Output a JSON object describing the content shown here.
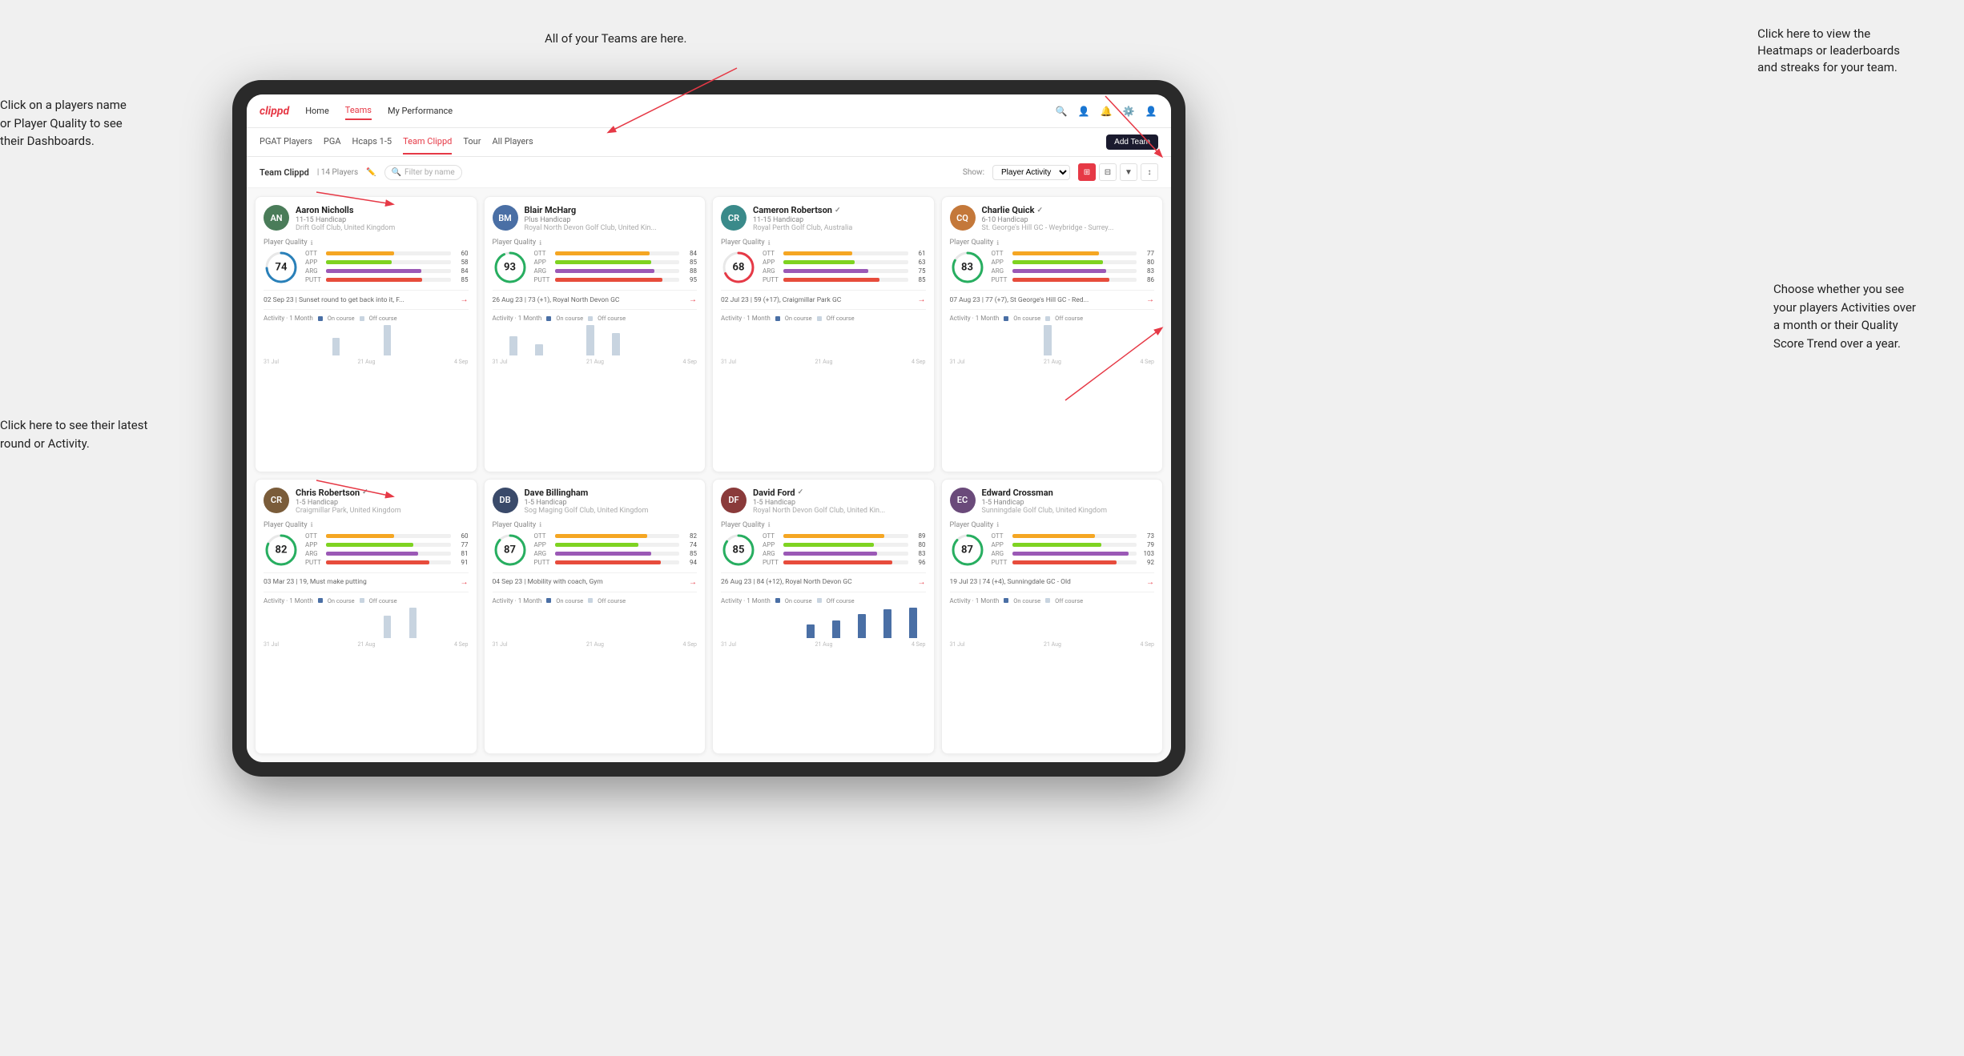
{
  "annotations": {
    "teams_label": "All of your Teams are here.",
    "heatmaps_label": "Click here to view the\nHeatmaps or leaderboards\nand streaks for your team.",
    "players_label": "Click on a players name\nor Player Quality to see\ntheir Dashboards.",
    "round_label": "Click here to see their latest\nround or Activity.",
    "activity_label": "Choose whether you see\nyour players Activities over\na month or their Quality\nScore Trend over a year."
  },
  "nav": {
    "logo": "clippd",
    "items": [
      "Home",
      "Teams",
      "My Performance"
    ],
    "active": "Teams"
  },
  "tabs": {
    "items": [
      "PGAT Players",
      "PGA",
      "Hcaps 1-5",
      "Team Clippd",
      "Tour",
      "All Players"
    ],
    "active": "Team Clippd",
    "add_team": "Add Team"
  },
  "team_header": {
    "title": "Team Clippd",
    "separator": "|",
    "count": "14 Players",
    "search_placeholder": "Filter by name",
    "show_label": "Show:",
    "show_option": "Player Activity",
    "view_options": [
      "grid",
      "grid4",
      "filter",
      "sort"
    ]
  },
  "players": [
    {
      "name": "Aaron Nicholls",
      "handicap": "11-15 Handicap",
      "club": "Drift Golf Club, United Kingdom",
      "quality": 74,
      "stats": [
        {
          "label": "OTT",
          "value": 60,
          "color": "#f5a623"
        },
        {
          "label": "APP",
          "value": 58,
          "color": "#7ed321"
        },
        {
          "label": "ARG",
          "value": 84,
          "color": "#9b59b6"
        },
        {
          "label": "PUTT",
          "value": 85,
          "color": "#e74c3c"
        }
      ],
      "latest_round": "02 Sep 23 | Sunset round to get back into it, F...",
      "activity_bars": [
        0,
        0,
        0,
        0,
        0,
        0,
        0,
        0,
        20,
        0,
        0,
        0,
        0,
        0,
        35,
        0,
        0,
        0,
        0,
        0,
        0,
        0,
        0,
        0
      ],
      "axis_labels": [
        "31 Jul",
        "21 Aug",
        "4 Sep"
      ],
      "initials": "AN",
      "av_class": "av-green"
    },
    {
      "name": "Blair McHarg",
      "handicap": "Plus Handicap",
      "club": "Royal North Devon Golf Club, United Kin...",
      "quality": 93,
      "stats": [
        {
          "label": "OTT",
          "value": 84,
          "color": "#f5a623"
        },
        {
          "label": "APP",
          "value": 85,
          "color": "#7ed321"
        },
        {
          "label": "ARG",
          "value": 88,
          "color": "#9b59b6"
        },
        {
          "label": "PUTT",
          "value": 95,
          "color": "#e74c3c"
        }
      ],
      "latest_round": "26 Aug 23 | 73 (+1), Royal North Devon GC",
      "activity_bars": [
        0,
        0,
        25,
        0,
        0,
        15,
        0,
        0,
        0,
        0,
        0,
        40,
        0,
        0,
        30,
        0,
        0,
        0,
        0,
        0,
        0,
        0,
        0,
        0
      ],
      "axis_labels": [
        "31 Jul",
        "21 Aug",
        "4 Sep"
      ],
      "initials": "BM",
      "av_class": "av-blue"
    },
    {
      "name": "Cameron Robertson",
      "verified": true,
      "handicap": "11-15 Handicap",
      "club": "Royal Perth Golf Club, Australia",
      "quality": 68,
      "stats": [
        {
          "label": "OTT",
          "value": 61,
          "color": "#f5a623"
        },
        {
          "label": "APP",
          "value": 63,
          "color": "#7ed321"
        },
        {
          "label": "ARG",
          "value": 75,
          "color": "#9b59b6"
        },
        {
          "label": "PUTT",
          "value": 85,
          "color": "#e74c3c"
        }
      ],
      "latest_round": "02 Jul 23 | 59 (+17), Craigmillar Park GC",
      "activity_bars": [
        0,
        0,
        0,
        0,
        0,
        0,
        0,
        0,
        0,
        0,
        0,
        0,
        0,
        0,
        0,
        0,
        0,
        0,
        0,
        0,
        0,
        0,
        0,
        0
      ],
      "axis_labels": [
        "31 Jul",
        "21 Aug",
        "4 Sep"
      ],
      "initials": "CR",
      "av_class": "av-teal"
    },
    {
      "name": "Charlie Quick",
      "verified": true,
      "handicap": "6-10 Handicap",
      "club": "St. George's Hill GC - Weybridge - Surrey...",
      "quality": 83,
      "stats": [
        {
          "label": "OTT",
          "value": 77,
          "color": "#f5a623"
        },
        {
          "label": "APP",
          "value": 80,
          "color": "#7ed321"
        },
        {
          "label": "ARG",
          "value": 83,
          "color": "#9b59b6"
        },
        {
          "label": "PUTT",
          "value": 86,
          "color": "#e74c3c"
        }
      ],
      "latest_round": "07 Aug 23 | 77 (+7), St George's Hill GC - Red...",
      "activity_bars": [
        0,
        0,
        0,
        0,
        0,
        0,
        0,
        0,
        0,
        0,
        0,
        20,
        0,
        0,
        0,
        0,
        0,
        0,
        0,
        0,
        0,
        0,
        0,
        0
      ],
      "axis_labels": [
        "31 Jul",
        "21 Aug",
        "4 Sep"
      ],
      "initials": "CQ",
      "av_class": "av-orange"
    },
    {
      "name": "Chris Robertson",
      "verified": true,
      "handicap": "1-5 Handicap",
      "club": "Craigmillar Park, United Kingdom",
      "quality": 82,
      "stats": [
        {
          "label": "OTT",
          "value": 60,
          "color": "#f5a623"
        },
        {
          "label": "APP",
          "value": 77,
          "color": "#7ed321"
        },
        {
          "label": "ARG",
          "value": 81,
          "color": "#9b59b6"
        },
        {
          "label": "PUTT",
          "value": 91,
          "color": "#e74c3c"
        }
      ],
      "latest_round": "03 Mar 23 | 19, Must make putting",
      "activity_bars": [
        0,
        0,
        0,
        0,
        0,
        0,
        0,
        0,
        0,
        0,
        0,
        0,
        0,
        0,
        20,
        0,
        0,
        28,
        0,
        0,
        0,
        0,
        0,
        0
      ],
      "axis_labels": [
        "31 Jul",
        "21 Aug",
        "4 Sep"
      ],
      "initials": "CR",
      "av_class": "av-brown"
    },
    {
      "name": "Dave Billingham",
      "handicap": "1-5 Handicap",
      "club": "Sog Maging Golf Club, United Kingdom",
      "quality": 87,
      "stats": [
        {
          "label": "OTT",
          "value": 82,
          "color": "#f5a623"
        },
        {
          "label": "APP",
          "value": 74,
          "color": "#7ed321"
        },
        {
          "label": "ARG",
          "value": 85,
          "color": "#9b59b6"
        },
        {
          "label": "PUTT",
          "value": 94,
          "color": "#e74c3c"
        }
      ],
      "latest_round": "04 Sep 23 | Mobility with coach, Gym",
      "activity_bars": [
        0,
        0,
        0,
        0,
        0,
        0,
        0,
        0,
        0,
        0,
        0,
        0,
        0,
        0,
        0,
        0,
        0,
        0,
        0,
        0,
        0,
        0,
        0,
        0
      ],
      "axis_labels": [
        "31 Jul",
        "21 Aug",
        "4 Sep"
      ],
      "initials": "DB",
      "av_class": "av-navy"
    },
    {
      "name": "David Ford",
      "verified": true,
      "handicap": "1-5 Handicap",
      "club": "Royal North Devon Golf Club, United Kin...",
      "quality": 85,
      "stats": [
        {
          "label": "OTT",
          "value": 89,
          "color": "#f5a623"
        },
        {
          "label": "APP",
          "value": 80,
          "color": "#7ed321"
        },
        {
          "label": "ARG",
          "value": 83,
          "color": "#9b59b6"
        },
        {
          "label": "PUTT",
          "value": 96,
          "color": "#e74c3c"
        }
      ],
      "latest_round": "26 Aug 23 | 84 (+12), Royal North Devon GC",
      "activity_bars": [
        0,
        0,
        0,
        0,
        0,
        0,
        0,
        0,
        0,
        0,
        30,
        0,
        0,
        40,
        0,
        0,
        55,
        0,
        0,
        65,
        0,
        0,
        70,
        0
      ],
      "axis_labels": [
        "31 Jul",
        "21 Aug",
        "4 Sep"
      ],
      "initials": "DF",
      "av_class": "av-red"
    },
    {
      "name": "Edward Crossman",
      "handicap": "1-5 Handicap",
      "club": "Sunningdale Golf Club, United Kingdom",
      "quality": 87,
      "stats": [
        {
          "label": "OTT",
          "value": 73,
          "color": "#f5a623"
        },
        {
          "label": "APP",
          "value": 79,
          "color": "#7ed321"
        },
        {
          "label": "ARG",
          "value": 103,
          "color": "#9b59b6"
        },
        {
          "label": "PUTT",
          "value": 92,
          "color": "#e74c3c"
        }
      ],
      "latest_round": "19 Jul 23 | 74 (+4), Sunningdale GC - Old",
      "activity_bars": [
        0,
        0,
        0,
        0,
        0,
        0,
        0,
        0,
        0,
        0,
        0,
        0,
        0,
        0,
        0,
        0,
        0,
        0,
        0,
        0,
        0,
        0,
        0,
        0
      ],
      "axis_labels": [
        "31 Jul",
        "21 Aug",
        "4 Sep"
      ],
      "initials": "EC",
      "av_class": "av-purple"
    }
  ],
  "activity": {
    "title": "Activity",
    "period": "1 Month",
    "on_course_label": "On course",
    "off_course_label": "Off course",
    "on_course_color": "#4a6fa5",
    "off_course_color": "#c8d4e0"
  }
}
